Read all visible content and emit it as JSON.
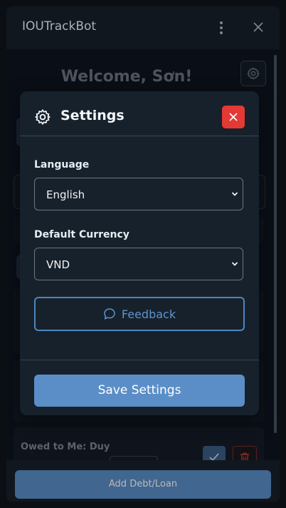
{
  "window": {
    "title": "IOUTrackBot"
  },
  "main": {
    "welcome": "Welcome, Sơn!",
    "owed_card": {
      "label": "Owed to Me: Duy"
    }
  },
  "footer": {
    "add_label": "Add Debt/Loan"
  },
  "settings_modal": {
    "title": "Settings",
    "language_label": "Language",
    "language_value": "English",
    "currency_label": "Default Currency",
    "currency_value": "VND",
    "feedback_label": "Feedback",
    "save_label": "Save Settings"
  },
  "colors": {
    "accent": "#5b8ec7",
    "danger": "#e53935",
    "panel": "#17212b",
    "background": "#0e1621"
  },
  "icons": {
    "menu": "kebab-menu-icon",
    "close": "close-icon",
    "settings": "gear-icon",
    "feedback": "speech-bubble-icon",
    "confirm": "check-icon",
    "delete": "trash-icon",
    "dropdown": "chevron-down-icon"
  }
}
